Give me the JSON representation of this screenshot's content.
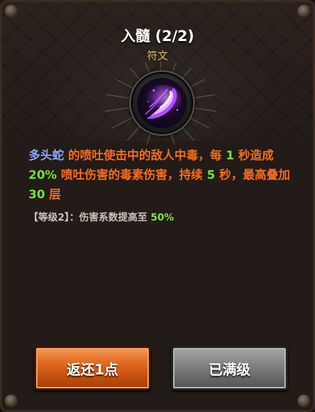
{
  "title": "入髓 (2/2)",
  "subtitle": "符文",
  "description": {
    "skill_name": "多头蛇",
    "t1": " 的喷吐使击中的敌人中毒，每 ",
    "n1": "1",
    "t2": " 秒造成 ",
    "n2": "20%",
    "t3": " 喷吐伤害的毒素伤害，持续 ",
    "n3": "5",
    "t4": " 秒，最高叠加 ",
    "n4": "30",
    "t5": " 层"
  },
  "level_info": {
    "label": "【等级2】：伤害系数提高至 ",
    "value": "50%"
  },
  "buttons": {
    "return_label": "返还1点",
    "maxed_label": "已满级"
  },
  "icon": "purple-spit-rune-icon",
  "colors": {
    "title": "#ffffff",
    "subtitle": "#d9b46a",
    "description_text": "#f36b20",
    "skill_name": "#8aa6ff",
    "number_highlight": "#6fe33c",
    "level_text": "#c9c2ba",
    "return_button": "#e36c22",
    "maxed_button": "#848484"
  }
}
